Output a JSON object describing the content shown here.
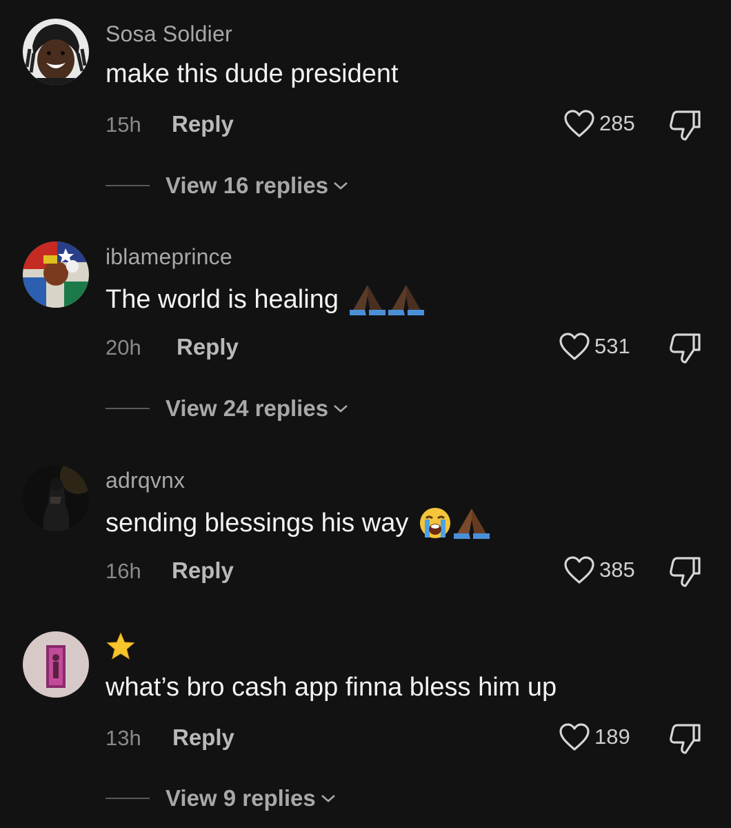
{
  "comments": [
    {
      "username": "Sosa Soldier",
      "text": "make this dude president",
      "time": "15h",
      "reply_label": "Reply",
      "likes": "285",
      "view_replies": "View 16 replies"
    },
    {
      "username": "iblameprince",
      "text": "The world is healing",
      "emojis": [
        "folded-hands",
        "folded-hands"
      ],
      "time": "20h",
      "reply_label": "Reply",
      "likes": "531",
      "view_replies": "View 24 replies"
    },
    {
      "username": "adrqvnx",
      "text": "sending blessings his way",
      "emojis": [
        "loudly-crying-face",
        "folded-hands"
      ],
      "time": "16h",
      "reply_label": "Reply",
      "likes": "385"
    },
    {
      "username": "⭐",
      "text": "what’s bro cash app finna bless him up",
      "time": "13h",
      "reply_label": "Reply",
      "likes": "189",
      "view_replies": "View 9 replies"
    }
  ],
  "colors": {
    "background": "#121212",
    "username": "#a8a8a8",
    "text": "#f3f3f3",
    "muted": "#8a8a8a"
  },
  "icons": [
    "heart-outline-icon",
    "thumbs-down-icon",
    "chevron-down-icon"
  ]
}
